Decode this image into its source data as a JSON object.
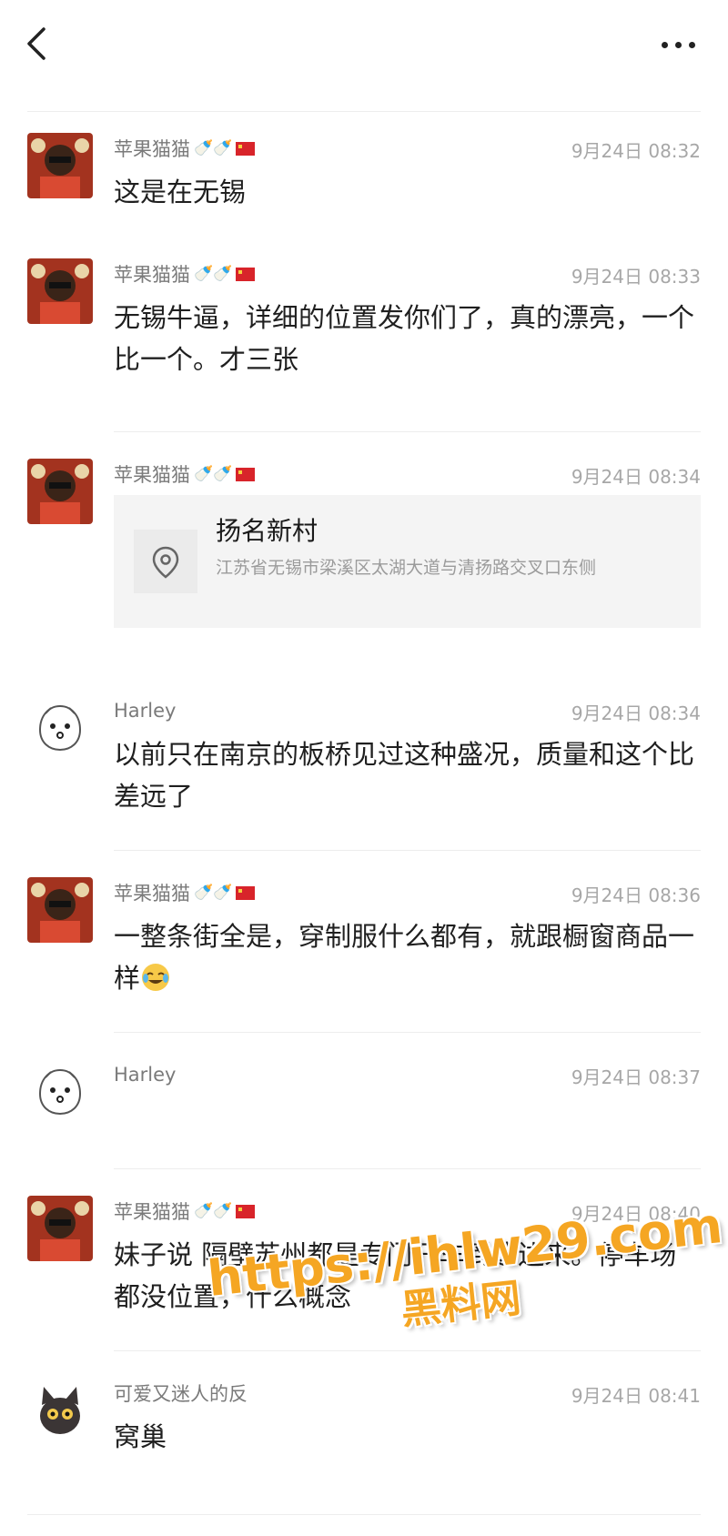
{
  "header": {
    "back_icon": "chevron-left-icon",
    "more_icon": "more-dots-icon"
  },
  "messages": [
    {
      "author": "苹果猫猫",
      "badges": "🍼🍼",
      "time": "9月24日 08:32",
      "text": "这是在无锡"
    },
    {
      "author": "苹果猫猫",
      "badges": "🍼🍼",
      "time": "9月24日 08:33",
      "text": "无锡牛逼，详细的位置发你们了，真的漂亮，一个比一个。才三张"
    },
    {
      "author": "苹果猫猫",
      "badges": "🍼🍼",
      "time": "9月24日 08:34",
      "location": {
        "title": "扬名新村",
        "address": "江苏省无锡市梁溪区太湖大道与清扬路交叉口东侧",
        "icon": "location-pin-icon"
      }
    },
    {
      "author": "Harley",
      "time": "9月24日 08:34",
      "text": "以前只在南京的板桥见过这种盛况，质量和这个比差远了"
    },
    {
      "author": "苹果猫猫",
      "badges": "🍼🍼",
      "time": "9月24日 08:36",
      "text": "一整条街全是，穿制服什么都有，就跟橱窗商品一样"
    },
    {
      "author": "Harley",
      "time": "9月24日 08:37",
      "text": ""
    },
    {
      "author": "苹果猫猫",
      "badges": "🍼🍼",
      "time": "9月24日 08:40",
      "text": "妹子说 隔壁苏州都是专门开车到这边来。停车场都没位置，什么概念"
    },
    {
      "author": "可爱又迷人的反",
      "time": "9月24日 08:41",
      "text": "窝巢"
    }
  ],
  "watermark": {
    "url": "https://ihlw29.com",
    "name": "黑料网"
  },
  "colors": {
    "accent_watermark": "#f5a623",
    "flag_red": "#d8242a"
  }
}
